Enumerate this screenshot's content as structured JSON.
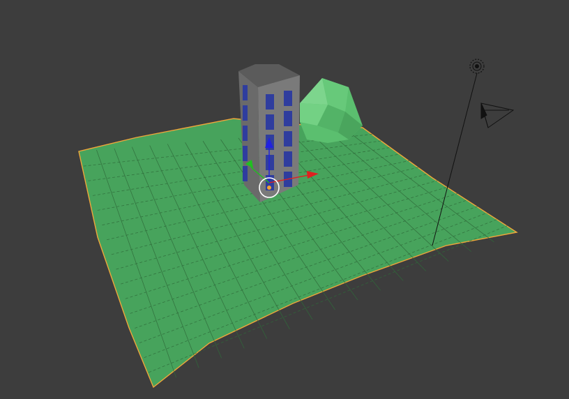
{
  "viewport": {
    "background_color": "#3d3d3d"
  },
  "objects": {
    "plane": {
      "type": "subdivided-plane-mesh",
      "fill_color": "#47a35c",
      "selected_edge_color": "#f0a63a",
      "grid_line_color": "#2f6b3a"
    },
    "hill": {
      "type": "low-poly-mesh",
      "fill_color": "#5bbf6f"
    },
    "building": {
      "type": "tower-mesh",
      "body_color": "#6f6f6f",
      "window_color": "#2f3d9e",
      "window_rows": 5,
      "window_cols_per_face": 2
    },
    "lamp": {
      "type": "lamp-object",
      "line_color": "#111111"
    },
    "camera": {
      "type": "camera-object",
      "line_color": "#111111"
    }
  },
  "gizmo": {
    "x_axis_color": "#e02020",
    "y_axis_color": "#20c020",
    "z_axis_color": "#2020e0",
    "origin_color": "#f5a530",
    "cursor_color": "#ffffff"
  }
}
